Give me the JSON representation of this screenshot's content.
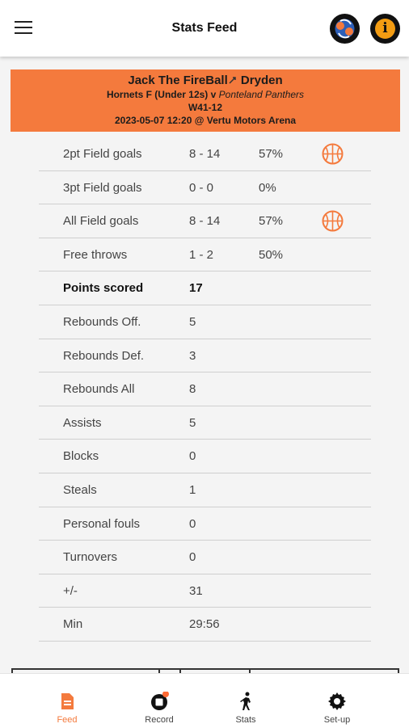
{
  "app": {
    "title": "Stats Feed",
    "menu_icon": "hamburger-menu-icon",
    "swap_icon": "swap-teams-icon",
    "info_icon": "info-icon",
    "info_glyph": "i"
  },
  "banner": {
    "player": "Jack  The FireBall🦍 Dryden",
    "player_prefix": "Jack  The FireBall",
    "player_suffix": " Dryden",
    "team": "Hornets F (Under 12s) v ",
    "opponent": "Ponteland Panthers",
    "result": "W41-12",
    "when": "2023-05-07 12:20  @ Vertu Motors Arena",
    "color": "#f47a3d"
  },
  "stats": [
    {
      "label": "2pt Field goals",
      "value": "8 - 14",
      "pct": "57%",
      "icon": "basketball-icon"
    },
    {
      "label": "3pt Field goals",
      "value": "0 - 0",
      "pct": "0%"
    },
    {
      "label": "All Field goals",
      "value": "8 - 14",
      "pct": "57%",
      "icon": "basketball-icon"
    },
    {
      "label": "Free throws",
      "value": "1 - 2",
      "pct": "50%"
    },
    {
      "label": "Points scored",
      "value": "17",
      "bold": true
    },
    {
      "label": "Rebounds Off.",
      "value": "5"
    },
    {
      "label": "Rebounds Def.",
      "value": "3"
    },
    {
      "label": "Rebounds All",
      "value": "8"
    },
    {
      "label": "Assists",
      "value": "5"
    },
    {
      "label": "Blocks",
      "value": "0"
    },
    {
      "label": "Steals",
      "value": "1"
    },
    {
      "label": "Personal fouls",
      "value": "0"
    },
    {
      "label": "Turnovers",
      "value": "0"
    },
    {
      "label": "+/-",
      "value": "31"
    },
    {
      "label": "Min",
      "value": "29:56"
    }
  ],
  "nav": [
    {
      "label": "Feed",
      "icon": "feed-document-icon",
      "active": true
    },
    {
      "label": "Record",
      "icon": "record-icon"
    },
    {
      "label": "Stats",
      "icon": "player-stats-icon"
    },
    {
      "label": "Set-up",
      "icon": "settings-gear-icon"
    }
  ],
  "colors": {
    "accent": "#f47a3d",
    "record_dot": "#ff6b35"
  }
}
